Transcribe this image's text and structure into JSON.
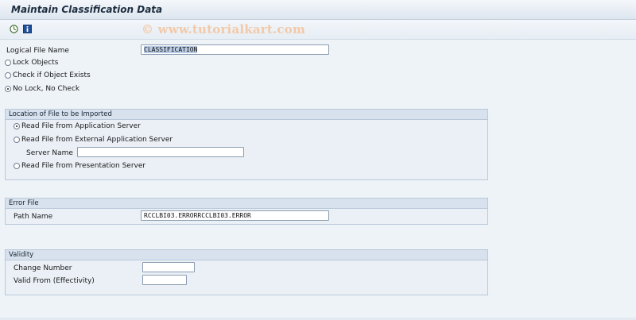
{
  "window": {
    "title": "Maintain Classification Data"
  },
  "toolbar": {
    "icons": [
      {
        "name": "execute-icon"
      },
      {
        "name": "info-icon"
      }
    ],
    "watermark": "© www.tutorialkart.com"
  },
  "general": {
    "logical_file_label": "Logical File Name",
    "logical_file_value": "CLASSIFICATION",
    "lock_options": [
      {
        "label": "Lock Objects",
        "selected": false
      },
      {
        "label": "Check if Object Exists",
        "selected": false
      },
      {
        "label": "No Lock, No Check",
        "selected": true
      }
    ]
  },
  "location": {
    "title": "Location of File to be Imported",
    "options": [
      {
        "label": "Read File from Application Server",
        "selected": true
      },
      {
        "label": "Read File from External Application Server",
        "selected": false
      },
      {
        "label": "Read File from Presentation Server",
        "selected": false
      }
    ],
    "server_name_label": "Server Name",
    "server_name_value": ""
  },
  "error_file": {
    "title": "Error File",
    "path_label": "Path Name",
    "path_value": "RCCLBI03.ERRORRCCLBI03.ERROR"
  },
  "validity": {
    "title": "Validity",
    "change_number_label": "Change Number",
    "change_number_value": "",
    "valid_from_label": "Valid From (Effectivity)",
    "valid_from_value": ""
  },
  "colors": {
    "background": "#eef3f8",
    "group_header": "#d7e2ee",
    "selection_highlight": "#b9cbe4"
  }
}
